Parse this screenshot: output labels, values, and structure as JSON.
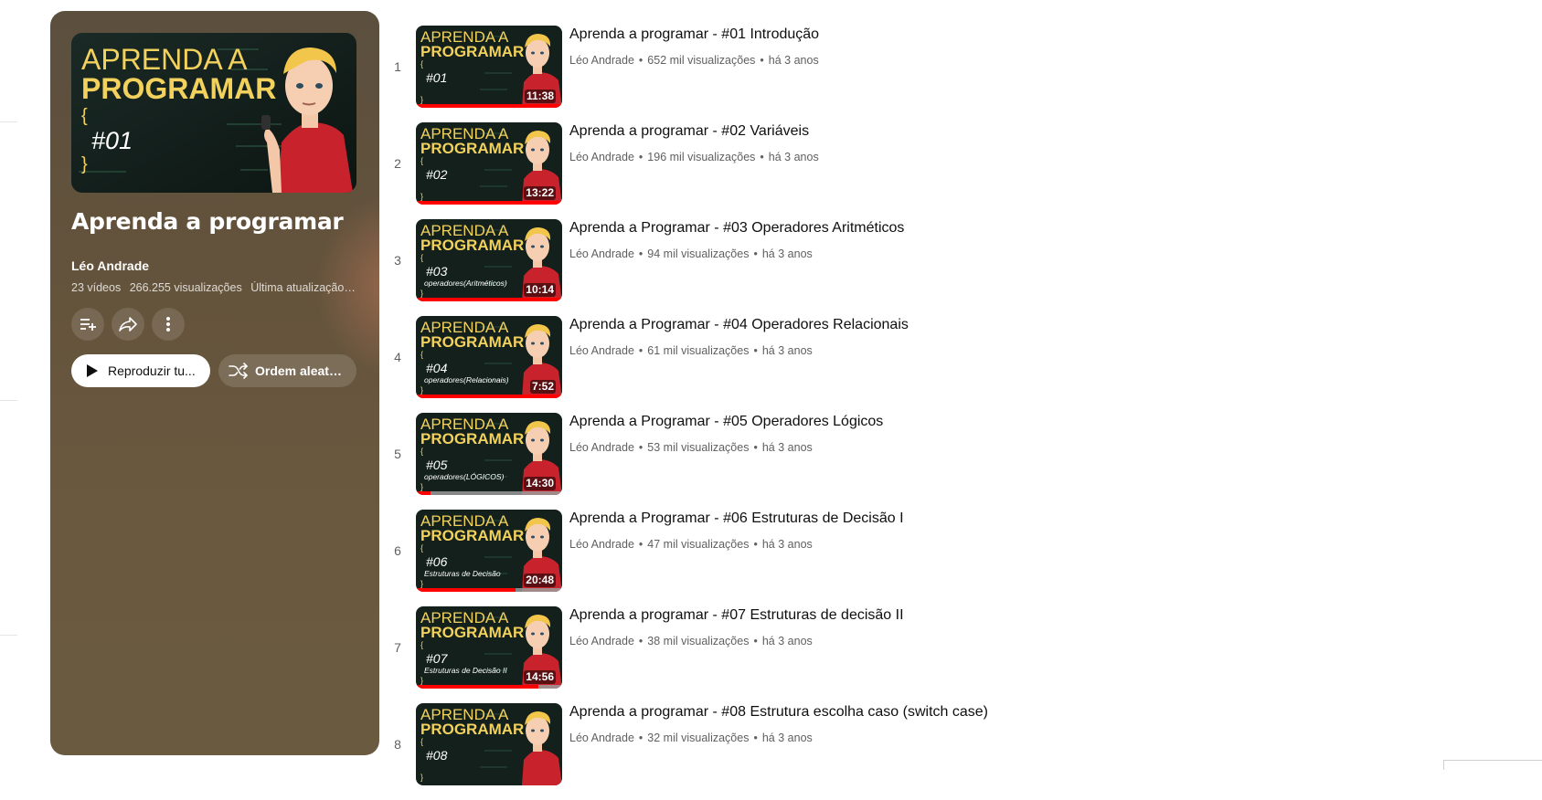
{
  "colors": {
    "panel_bg": "#64533c",
    "progress": "#ff0000",
    "thumb_text": "#f2d15c"
  },
  "playlist": {
    "title": "Aprenda a programar",
    "channel": "Léo Andrade",
    "video_count": "23 vídeos",
    "views": "266.255 visualizações",
    "updated": "Última atualização em...",
    "hero_thumb": {
      "line1": "APRENDA A",
      "line2": "PROGRAMAR",
      "brace_open": "{",
      "code": "#01",
      "brace_close": "}"
    },
    "actions": {
      "save_icon": "playlist-add-icon",
      "share_icon": "share-icon",
      "more_icon": "more-vert-icon",
      "play_all": "Reproduzir tu...",
      "shuffle": "Ordem aleató..."
    }
  },
  "videos": [
    {
      "index": "1",
      "title": "Aprenda a programar - #01 Introdução",
      "channel": "Léo Andrade",
      "views": "652 mil visualizações",
      "age": "há 3 anos",
      "duration": "11:38",
      "progress": 1.0,
      "thumb": {
        "line1": "APRENDA A",
        "line2": "PROGRAMAR",
        "code": "#01",
        "subtitle": ""
      }
    },
    {
      "index": "2",
      "title": "Aprenda a programar - #02 Variáveis",
      "channel": "Léo Andrade",
      "views": "196 mil visualizações",
      "age": "há 3 anos",
      "duration": "13:22",
      "progress": 1.0,
      "thumb": {
        "line1": "APRENDA A",
        "line2": "PROGRAMAR",
        "code": "#02",
        "subtitle": ""
      }
    },
    {
      "index": "3",
      "title": "Aprenda a Programar - #03 Operadores Aritméticos",
      "channel": "Léo Andrade",
      "views": "94 mil visualizações",
      "age": "há 3 anos",
      "duration": "10:14",
      "progress": 1.0,
      "thumb": {
        "line1": "APRENDA A",
        "line2": "PROGRAMAR",
        "code": "#03",
        "subtitle": "operadores(Aritméticos)"
      }
    },
    {
      "index": "4",
      "title": "Aprenda a Programar - #04 Operadores Relacionais",
      "channel": "Léo Andrade",
      "views": "61 mil visualizações",
      "age": "há 3 anos",
      "duration": "7:52",
      "progress": 1.0,
      "thumb": {
        "line1": "APRENDA A",
        "line2": "PROGRAMAR",
        "code": "#04",
        "subtitle": "operadores(Relacionais)"
      }
    },
    {
      "index": "5",
      "title": "Aprenda a Programar - #05 Operadores Lógicos",
      "channel": "Léo Andrade",
      "views": "53 mil visualizações",
      "age": "há 3 anos",
      "duration": "14:30",
      "progress": 0.1,
      "thumb": {
        "line1": "APRENDA A",
        "line2": "PROGRAMAR",
        "code": "#05",
        "subtitle": "operadores(LÓGICOS)"
      }
    },
    {
      "index": "6",
      "title": "Aprenda a Programar - #06 Estruturas de Decisão I",
      "channel": "Léo Andrade",
      "views": "47 mil visualizações",
      "age": "há 3 anos",
      "duration": "20:48",
      "progress": 0.68,
      "thumb": {
        "line1": "APRENDA A",
        "line2": "PROGRAMAR",
        "code": "#06",
        "subtitle": "Estruturas de Decisão"
      }
    },
    {
      "index": "7",
      "title": "Aprenda a programar - #07 Estruturas de decisão II",
      "channel": "Léo Andrade",
      "views": "38 mil visualizações",
      "age": "há 3 anos",
      "duration": "14:56",
      "progress": 0.84,
      "thumb": {
        "line1": "APRENDA A",
        "line2": "PROGRAMAR",
        "code": "#07",
        "subtitle": "Estruturas de Decisão II"
      }
    },
    {
      "index": "8",
      "title": "Aprenda a programar - #08 Estrutura escolha caso (switch case)",
      "channel": "Léo Andrade",
      "views": "32 mil visualizações",
      "age": "há 3 anos",
      "duration": "",
      "progress": 0,
      "thumb": {
        "line1": "APRENDA A",
        "line2": "PROGRAMAR",
        "code": "#08",
        "subtitle": ""
      }
    }
  ]
}
